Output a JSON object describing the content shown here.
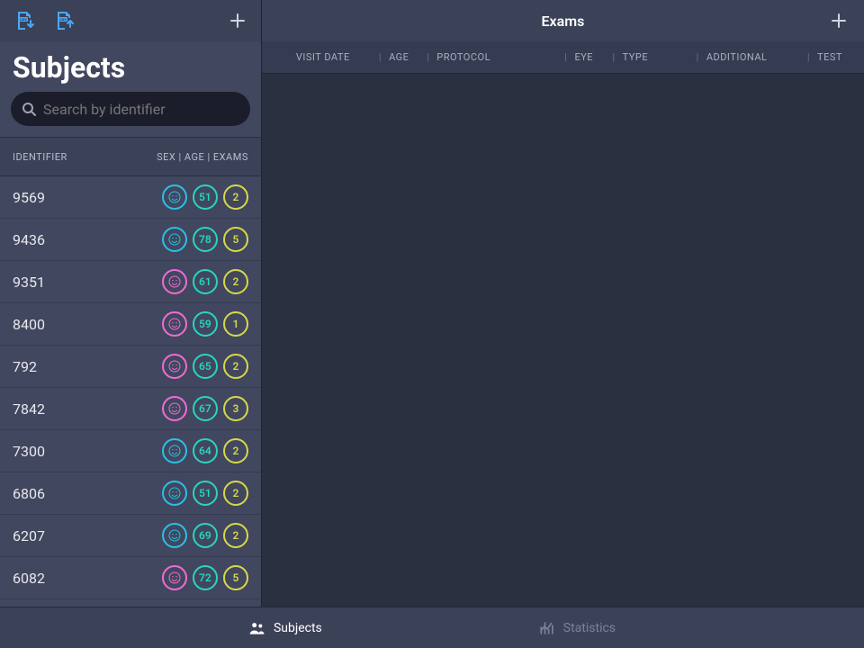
{
  "sidebar": {
    "title": "Subjects",
    "search_placeholder": "Search by identifier",
    "header_identifier": "IDENTIFIER",
    "header_right": "SEX  |  AGE  |  EXAMS"
  },
  "subjects": [
    {
      "id": "9569",
      "sex": "M",
      "age": "51",
      "exams": "2"
    },
    {
      "id": "9436",
      "sex": "M",
      "age": "78",
      "exams": "5"
    },
    {
      "id": "9351",
      "sex": "F",
      "age": "61",
      "exams": "2"
    },
    {
      "id": "8400",
      "sex": "F",
      "age": "59",
      "exams": "1"
    },
    {
      "id": "792",
      "sex": "F",
      "age": "65",
      "exams": "2"
    },
    {
      "id": "7842",
      "sex": "F",
      "age": "67",
      "exams": "3"
    },
    {
      "id": "7300",
      "sex": "M",
      "age": "64",
      "exams": "2"
    },
    {
      "id": "6806",
      "sex": "M",
      "age": "51",
      "exams": "2"
    },
    {
      "id": "6207",
      "sex": "M",
      "age": "69",
      "exams": "2"
    },
    {
      "id": "6082",
      "sex": "F",
      "age": "72",
      "exams": "5"
    }
  ],
  "exams": {
    "title": "Exams",
    "columns": [
      "VISIT DATE",
      "AGE",
      "PROTOCOL",
      "EYE",
      "TYPE",
      "ADDITIONAL",
      "TEST"
    ]
  },
  "bottomnav": {
    "subjects": "Subjects",
    "statistics": "Statistics"
  },
  "colors": {
    "male": "#29c0e8",
    "female": "#f06bd4",
    "age": "#29d4c0",
    "exams": "#d6d84a"
  }
}
